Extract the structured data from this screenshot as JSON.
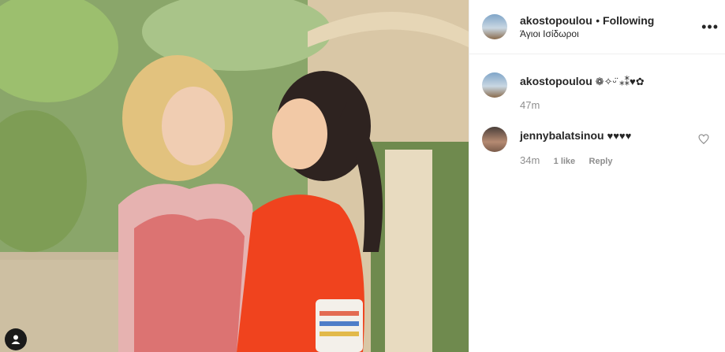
{
  "post": {
    "username": "akostopoulou",
    "follow_status": "Following",
    "location": "Άγιοι Ισίδωροι"
  },
  "comments": [
    {
      "username": "akostopoulou",
      "text": "❁✧ᵕ̈ ⁎⁑♥✿",
      "time": "47m"
    },
    {
      "username": "jennybalatsinou",
      "text": "♥♥♥♥",
      "time": "34m",
      "likes": "1 like",
      "reply": "Reply"
    }
  ],
  "icons": {
    "more": "more-options-icon",
    "like": "heart-icon",
    "user_tag": "user-tag-icon"
  },
  "colors": {
    "text": "#262626",
    "muted": "#8e8e8e",
    "border": "#efefef"
  }
}
